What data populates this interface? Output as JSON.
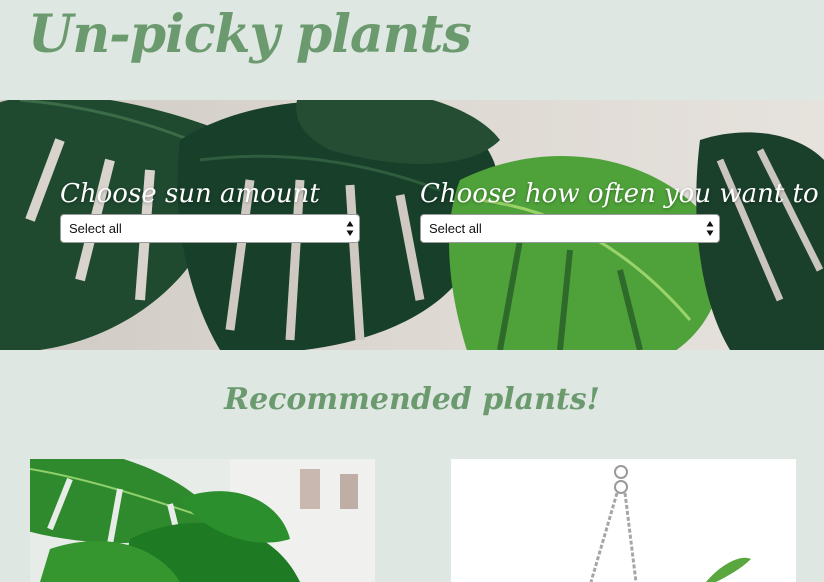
{
  "header": {
    "title": "Un-picky plants"
  },
  "filters": {
    "sun": {
      "label": "Choose sun amount",
      "selected": "Select all"
    },
    "water": {
      "label": "Choose how often you want to water",
      "selected": "Select all"
    }
  },
  "recommended": {
    "heading": "Recommended plants!",
    "cards": [
      {
        "image": "monstera-plant-photo"
      },
      {
        "image": "hanging-plant-photo"
      }
    ]
  },
  "colors": {
    "page_background": "#dfe7e3",
    "accent_green": "#6c9a6f"
  }
}
